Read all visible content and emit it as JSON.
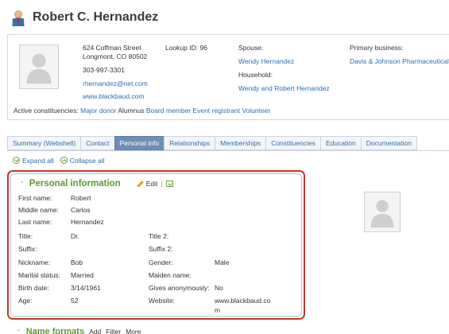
{
  "header": {
    "name": "Robert C. Hernandez"
  },
  "summary": {
    "address_line1": "624 Coffman Street",
    "address_line2": "Longmont, CO  80502",
    "phone": "303-997-3301",
    "email": "rhernandez@net.com",
    "website": "www.blackbaud.com",
    "lookup_label": "Lookup ID:",
    "lookup_value": "96",
    "spouse_label": "Spouse:",
    "spouse_value": "Wendy Hernandez",
    "household_label": "Household:",
    "household_value": "Wendy and Robert Hernandez",
    "business_label": "Primary business:",
    "business_value": "Davis & Johnson Pharmaceuticals",
    "constituencies_label": "Active constituencies:",
    "constituencies": [
      "Major donor",
      "Alumnus",
      "Board member",
      "Event registrant",
      "Volunteer"
    ]
  },
  "tabs": [
    "Summary (Webshell)",
    "Contact",
    "Personal info",
    "Relationships",
    "Memberships",
    "Constituencies",
    "Education",
    "Documentation"
  ],
  "active_tab": "Personal info",
  "toolbar": {
    "expand_all": "Expand all",
    "collapse_all": "Collapse all"
  },
  "personal_info": {
    "title": "Personal information",
    "edit_label": "Edit",
    "left_fields": [
      {
        "label": "First name:",
        "value": "Robert"
      },
      {
        "label": "Middle name:",
        "value": "Carlos"
      },
      {
        "label": "Last name:",
        "value": "Hernandez"
      },
      {
        "label": "Title:",
        "value": "Dr."
      },
      {
        "label": "Suffix:",
        "value": ""
      },
      {
        "label": "Nickname:",
        "value": "Bob"
      },
      {
        "label": "Marital status:",
        "value": "Married"
      },
      {
        "label": "Birth date:",
        "value": "3/14/1961"
      },
      {
        "label": "Age:",
        "value": "52"
      }
    ],
    "right_fields": [
      {
        "label": "Title 2:",
        "value": ""
      },
      {
        "label": "Suffix 2:",
        "value": ""
      },
      {
        "label": "Gender:",
        "value": "Male"
      },
      {
        "label": "Maiden name:",
        "value": ""
      },
      {
        "label": "Gives anonymously:",
        "value": "No"
      },
      {
        "label": "Website:",
        "value_line1": "www.blackbaud.co",
        "value_line2": "m"
      }
    ]
  },
  "next_section": {
    "title": "Name formats",
    "add_label": "Add",
    "filter_label": "Filter",
    "more_label": "More"
  }
}
